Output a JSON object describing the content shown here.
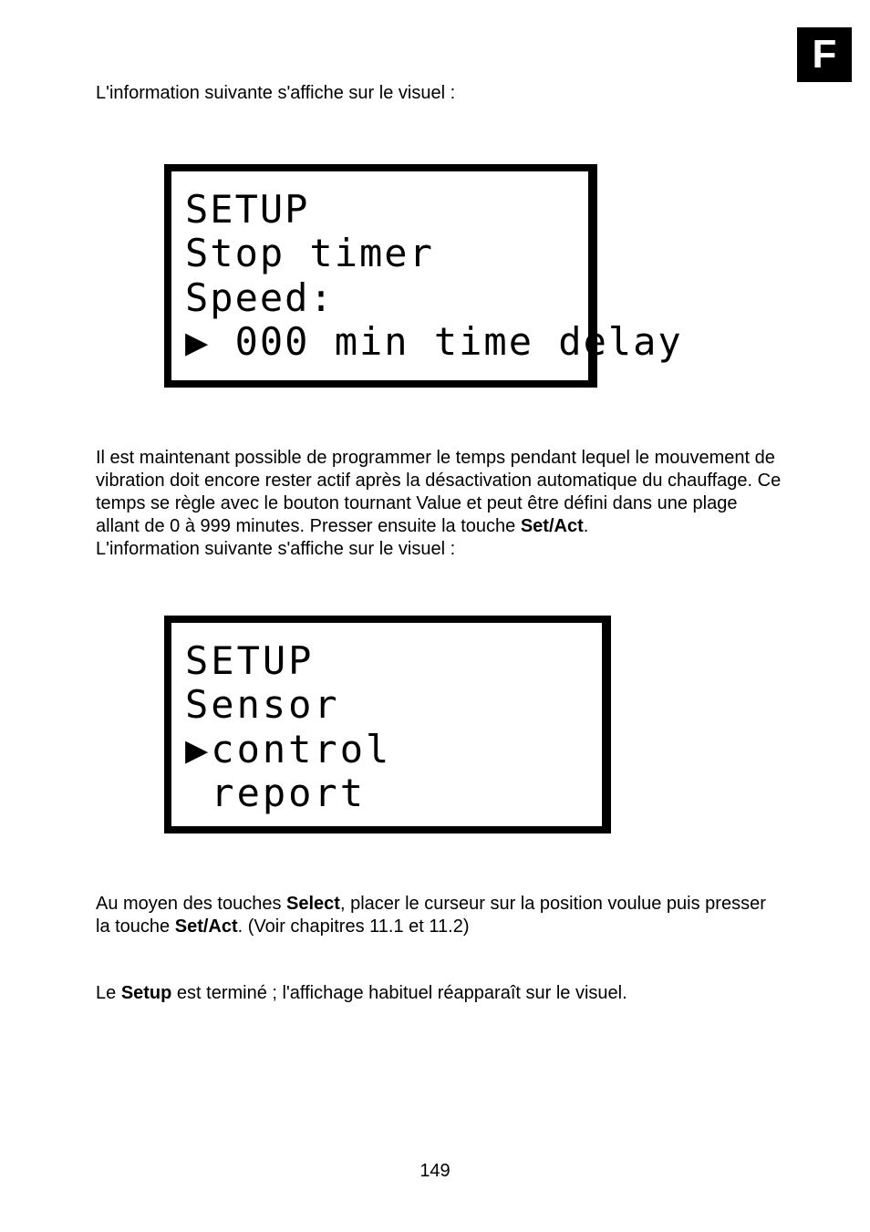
{
  "sectionLetter": "F",
  "intro1": "L'information suivante s'affiche sur le visuel :",
  "lcd1": {
    "line1": "SETUP",
    "line2": "Stop timer",
    "line3": "Speed:",
    "line4": "▶ 000 min time delay"
  },
  "para2_part1": "Il est maintenant possible de programmer le temps pendant lequel le mouvement de vibration doit encore rester actif après la désactivation automatique du chauffage. Ce temps se règle avec le bouton tournant Value et peut être défini dans une plage allant de 0 à 999 minutes. Presser ensuite la touche ",
  "para2_bold1": "Set/Act",
  "para2_part2": ".",
  "para2_line2": "L'information suivante s'affiche sur le visuel :",
  "lcd2": {
    "line1": "SETUP",
    "line2": "Sensor",
    "line3": "▶control",
    "line4": " report"
  },
  "para3_part1": "Au moyen des touches ",
  "para3_bold1": "Select",
  "para3_part2": ", placer le curseur sur la position voulue puis presser la touche ",
  "para3_bold2": "Set/Act",
  "para3_part3": ". (Voir chapitres 11.1 et 11.2)",
  "para4_part1": "Le ",
  "para4_bold1": "Setup",
  "para4_part2": " est terminé ; l'affichage habituel réapparaît sur le visuel.",
  "pageNumber": "149"
}
